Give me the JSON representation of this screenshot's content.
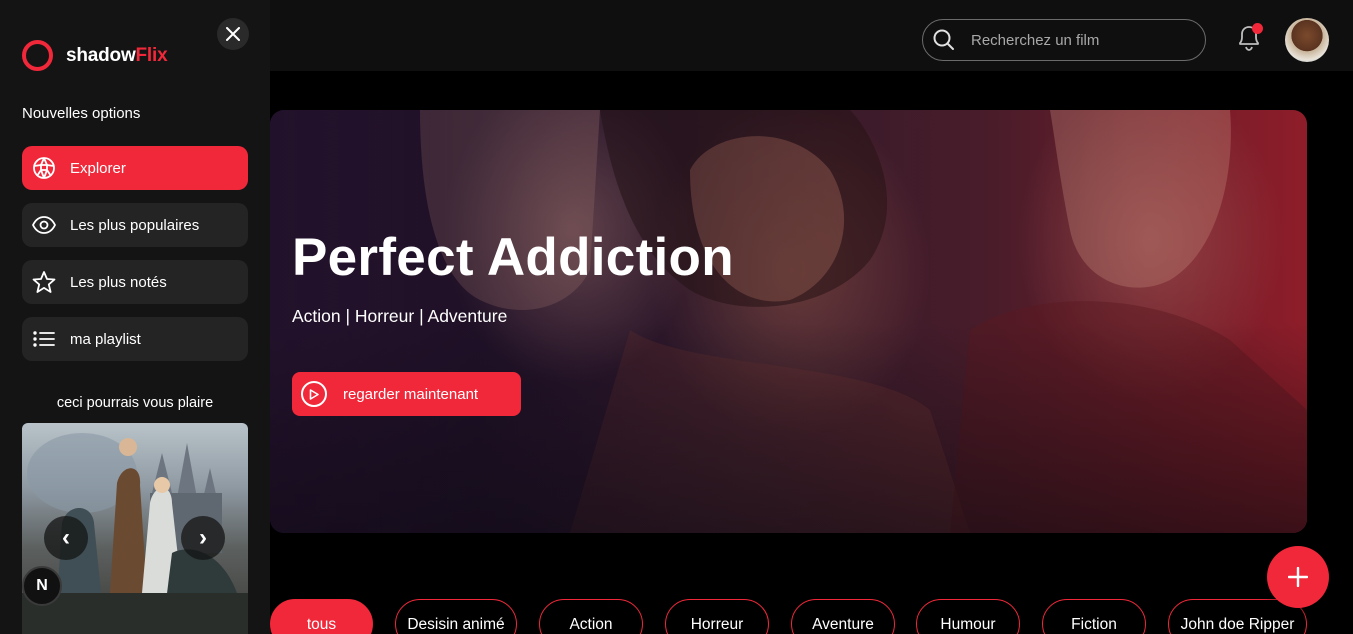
{
  "brand": {
    "name_part1": "shadow",
    "name_part2": "Flix",
    "accent": "#f0283a"
  },
  "sidebar": {
    "section_title": "Nouvelles options",
    "items": [
      {
        "label": "Explorer",
        "icon": "compass-icon",
        "active": true
      },
      {
        "label": "Les plus populaires",
        "icon": "eye-icon",
        "active": false
      },
      {
        "label": "Les plus notés",
        "icon": "star-icon",
        "active": false
      },
      {
        "label": "ma playlist",
        "icon": "list-icon",
        "active": false
      }
    ],
    "suggestion_title": "ceci pourrais vous plaire",
    "carousel": {
      "prev": "‹",
      "next": "›"
    },
    "badge": "N"
  },
  "topbar": {
    "search_placeholder": "Recherchez un film"
  },
  "hero": {
    "title": "Perfect Addiction",
    "genres": "Action | Horreur | Adventure",
    "cta_label": "regarder maintenant"
  },
  "categories": [
    "tous",
    "Desisin animé",
    "Action",
    "Horreur",
    "Aventure",
    "Humour",
    "Fiction",
    "John doe Ripper"
  ]
}
